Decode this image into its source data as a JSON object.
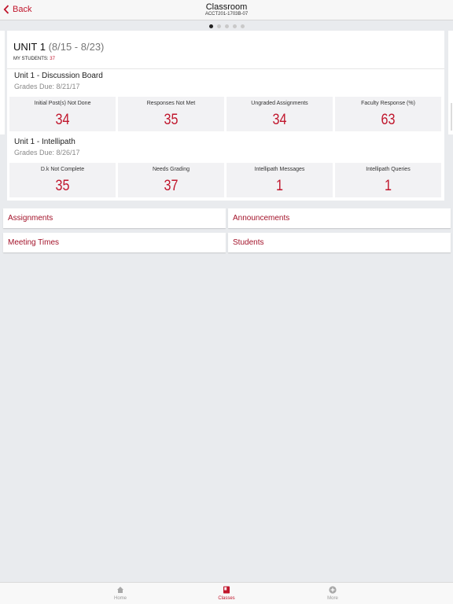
{
  "navbar": {
    "back_label": "Back",
    "title": "Classroom",
    "subtitle": "ACCT201-1703B-07"
  },
  "pager": {
    "count": 5,
    "active_index": 0
  },
  "unit": {
    "title": "UNIT 1",
    "dates": "(8/15 - 8/23)",
    "my_students_label": "MY STUDENTS:",
    "my_students_count": "37"
  },
  "sections": [
    {
      "title": "Unit 1 - Discussion Board",
      "due": "Grades Due: 8/21/17",
      "metrics": [
        {
          "label": "Initial Post(s) Not Done",
          "value": "34"
        },
        {
          "label": "Responses Not Met",
          "value": "35"
        },
        {
          "label": "Ungraded Assignments",
          "value": "34"
        },
        {
          "label": "Faculty Response (%)",
          "value": "63"
        }
      ]
    },
    {
      "title": "Unit 1 - Intellipath",
      "due": "Grades Due: 8/26/17",
      "metrics": [
        {
          "label": "D.k Not Complete",
          "value": "35"
        },
        {
          "label": "Needs Grading",
          "value": "37"
        },
        {
          "label": "Intellipath Messages",
          "value": "1"
        },
        {
          "label": "Intellipath Queries",
          "value": "1"
        }
      ]
    }
  ],
  "links": {
    "assignments": "Assignments",
    "announcements": "Announcements",
    "meeting_times": "Meeting Times",
    "students": "Students"
  },
  "tabbar": {
    "home": "Home",
    "classes": "Classes",
    "more": "More",
    "active": "classes"
  },
  "colors": {
    "accent": "#c0162c",
    "background": "#e9ebee"
  }
}
